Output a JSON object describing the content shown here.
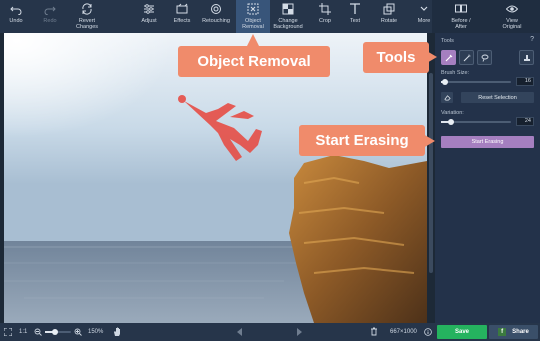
{
  "toolbar": {
    "undo": "Undo",
    "redo": "Redo",
    "revert": "Revert Changes",
    "adjust": "Adjust",
    "effects": "Effects",
    "retouching": "Retouching",
    "object_removal": "Object Removal",
    "change_background": "Change Background",
    "crop": "Crop",
    "text": "Text",
    "rotate": "Rotate",
    "more": "More",
    "before_after": "Before / After",
    "view_original": "View Original"
  },
  "panel": {
    "section_title": "Tools",
    "help": "?",
    "brush_size_label": "Brush Size:",
    "brush_size_value": "16",
    "brush_size_fraction": 0.06,
    "reset_selection": "Reset Selection",
    "variation_label": "Variation:",
    "variation_value": "24",
    "variation_fraction": 0.14,
    "start_erasing": "Start Erasing"
  },
  "bottom": {
    "ratio": "1:1",
    "zoom": "150%",
    "dimensions": "667×1000",
    "save": "Save",
    "share": "Share",
    "zoom_fraction": 0.4
  },
  "callouts": {
    "object_removal": "Object Removal",
    "tools": "Tools",
    "start_erasing": "Start Erasing"
  },
  "colors": {
    "accent_purple": "#a57fc0",
    "callout_orange": "#f08b6b",
    "save_green": "#25b35f",
    "selection_red": "#e8453c"
  }
}
